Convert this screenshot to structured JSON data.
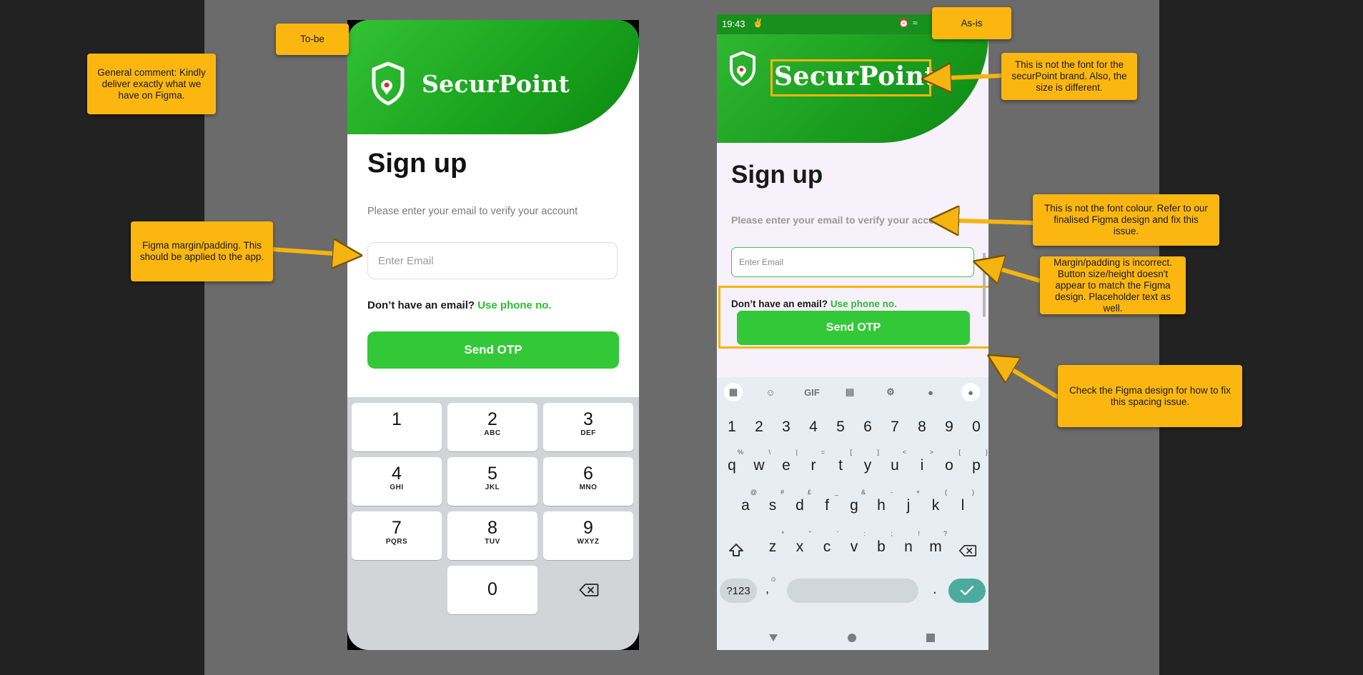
{
  "notes": {
    "general": "General comment: Kindly deliver exactly what we have on Figma.",
    "to_be": "To-be",
    "as_is": "As-is",
    "figma_margin": "Figma margin/padding. This should be applied to the app.",
    "font_brand": "This is not the font for the securPoint brand. Also, the size is different.",
    "font_colour": "This is not the font colour. Refer to our finalised Figma design and fix this issue.",
    "margin_incorrect": "Margin/padding is incorrect. Button size/height doesn't appear to match the Figma design. Placeholder text as well.",
    "spacing": "Check the Figma design for how to fix this spacing issue."
  },
  "tobe": {
    "brand": "SecurPoint",
    "title": "Sign up",
    "subtitle": "Please enter your email to verify your account",
    "email_placeholder": "Enter Email",
    "no_email": "Don’t have an email?",
    "use_phone": "Use phone no.",
    "send_otp": "Send OTP",
    "numpad": [
      {
        "d": "1",
        "l": ""
      },
      {
        "d": "2",
        "l": "ABC"
      },
      {
        "d": "3",
        "l": "DEF"
      },
      {
        "d": "4",
        "l": "GHI"
      },
      {
        "d": "5",
        "l": "JKL"
      },
      {
        "d": "6",
        "l": "MNO"
      },
      {
        "d": "7",
        "l": "PQRS"
      },
      {
        "d": "8",
        "l": "TUV"
      },
      {
        "d": "9",
        "l": "WXYZ"
      },
      {
        "d": "0",
        "l": ""
      }
    ]
  },
  "asis": {
    "time": "19:43",
    "brand": "SecurPoint",
    "title": "Sign up",
    "subtitle": "Please enter your email to verify your account",
    "email_placeholder": "Enter Email",
    "no_email": "Don’t have an email?",
    "use_phone": "Use phone no.",
    "send_otp": "Send OTP",
    "keyboard": {
      "toolbar_gif": "GIF",
      "digits": [
        "1",
        "2",
        "3",
        "4",
        "5",
        "6",
        "7",
        "8",
        "9",
        "0"
      ],
      "row1": [
        {
          "k": "q",
          "s": "%"
        },
        {
          "k": "w",
          "s": "\\"
        },
        {
          "k": "e",
          "s": "|"
        },
        {
          "k": "r",
          "s": "="
        },
        {
          "k": "t",
          "s": "["
        },
        {
          "k": "y",
          "s": "]"
        },
        {
          "k": "u",
          "s": "<"
        },
        {
          "k": "i",
          "s": ">"
        },
        {
          "k": "o",
          "s": "{"
        },
        {
          "k": "p",
          "s": "}"
        }
      ],
      "row2": [
        {
          "k": "a",
          "s": "@"
        },
        {
          "k": "s",
          "s": "#"
        },
        {
          "k": "d",
          "s": "£"
        },
        {
          "k": "f",
          "s": "_"
        },
        {
          "k": "g",
          "s": "&"
        },
        {
          "k": "h",
          "s": "-"
        },
        {
          "k": "j",
          "s": "+"
        },
        {
          "k": "k",
          "s": "("
        },
        {
          "k": "l",
          "s": ")"
        }
      ],
      "row3": [
        {
          "k": "z",
          "s": "*"
        },
        {
          "k": "x",
          "s": "\""
        },
        {
          "k": "c",
          "s": "'"
        },
        {
          "k": "v",
          "s": ":"
        },
        {
          "k": "b",
          "s": ";"
        },
        {
          "k": "n",
          "s": "!"
        },
        {
          "k": "m",
          "s": "?"
        }
      ],
      "symbols": "?123",
      "comma": ",",
      "period": "."
    }
  },
  "colors": {
    "brand_green": "#33c838",
    "note_yellow": "#fbb710",
    "link_green": "#2bbd2e"
  }
}
